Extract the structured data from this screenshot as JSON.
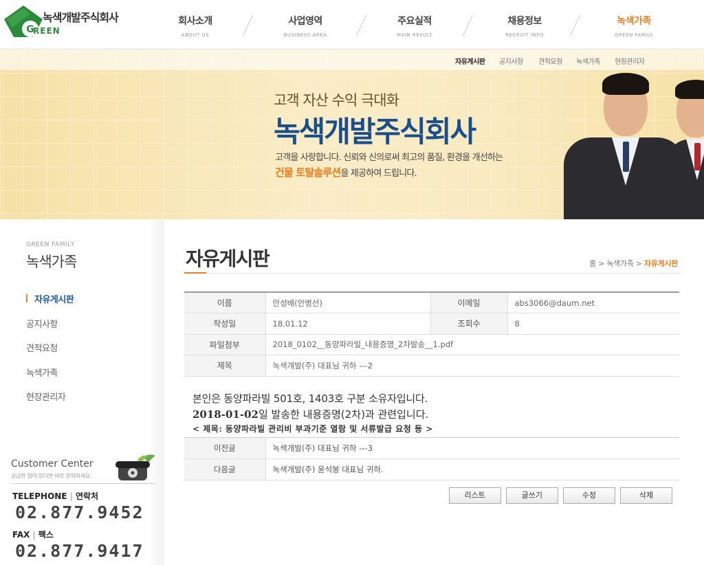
{
  "header": {
    "logo_text": "녹색개발주식회사",
    "logo_sub": "REEN",
    "logo_letter": "G",
    "nav": [
      {
        "label": "회사소개",
        "en": "ABOUT US"
      },
      {
        "label": "사업영역",
        "en": "BUSINESS AREA"
      },
      {
        "label": "주요실적",
        "en": "MAIN RESULT"
      },
      {
        "label": "채용정보",
        "en": "RECRUIT INFO"
      },
      {
        "label": "녹색가족",
        "en": "GREEN FAMILY"
      }
    ],
    "active_nav_index": 4
  },
  "subnav": {
    "items": [
      "자유게시판",
      "공지사항",
      "견적요청",
      "녹색가족",
      "현장관리자"
    ]
  },
  "visual": {
    "slogan": "고객 자산 수익 극대화",
    "title": "녹색개발주식회사",
    "desc1": "고객을 사랑합니다. 신뢰와 신의로써 최고의 품질, 환경을 개선하는",
    "desc2_highlight": "건물 토탈솔루션",
    "desc2_rest": "을 제공하여 드립니다."
  },
  "sidebar": {
    "title_en": "GREEN FAMILY",
    "title": "녹색가족",
    "menu": [
      "자유게시판",
      "공지사항",
      "견적요청",
      "녹색가족",
      "현장관리자"
    ],
    "active_index": 0
  },
  "customer_center": {
    "title": "Customer Center",
    "subtitle": "궁금한 점이 있다면 바로 문의하세요.",
    "tel_label": "TELEPHONE",
    "tel_label_ko": "연락처",
    "tel": "02.877.9452",
    "fax_label": "FAX",
    "fax_label_ko": "팩스",
    "fax": "02.877.9417"
  },
  "page": {
    "title": "자유게시판",
    "breadcrumb": {
      "home": "홈",
      "section": "녹색가족",
      "current": "자유게시판"
    }
  },
  "post": {
    "name_label": "이름",
    "name": "안성배(안병선)",
    "email_label": "이메일",
    "email": "abs3066@daum.net",
    "date_label": "작성일",
    "date": "18.01.12",
    "views_label": "조회수",
    "views": "8",
    "file_label": "파일첨부",
    "file": "2018_0102__동양파라빌_내용증명_2차발송__1.pdf",
    "subject_label": "제목",
    "subject": "녹색개발(주) 대표님 귀하 ---2",
    "body_line1": "본인은 동양파라빌 501호, 1403호 구분 소유자입니다.",
    "body_line2_bold": "2018-01-02",
    "body_line2_rest": "일 발송한 내용증명(2차)과 관련입니다.",
    "body_line3": "< 제목: 동양파라빌 관리비 부과기준 열람 및 서류발급 요청 등 >"
  },
  "nav_posts": {
    "prev_label": "이전글",
    "prev": "녹색개발(주) 대표님 귀하 ---3",
    "next_label": "다음글",
    "next": "녹색개발(주) 윤석붕 대표님 귀하."
  },
  "buttons": {
    "list": "리스트",
    "write": "글쓰기",
    "edit": "수정",
    "delete": "삭제"
  },
  "colors": {
    "accent": "#f07d1e",
    "brand_green": "#2d8a3a",
    "title_blue": "#1b4f8c"
  }
}
